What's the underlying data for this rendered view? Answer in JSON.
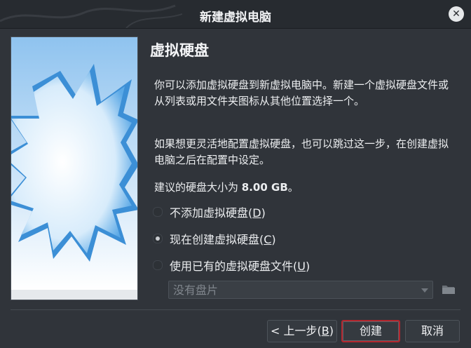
{
  "window": {
    "title": "新建虚拟电脑",
    "close_icon": "close-icon"
  },
  "page": {
    "title": "虚拟硬盘",
    "description_1": "你可以添加虚拟硬盘到新虚拟电脑中。新建一个虚拟硬盘文件或从列表或用文件夹图标从其他位置选择一个。",
    "description_2": "如果想更灵活地配置虚拟硬盘，也可以跳过这一步，在创建虚拟电脑之后在配置中设定。",
    "recommend_prefix": "建议的硬盘大小为 ",
    "recommend_size": "8.00 GB",
    "recommend_suffix": "。"
  },
  "options": [
    {
      "label": "不添加虚拟硬盘(",
      "key": "D",
      "end": ")",
      "selected": false
    },
    {
      "label": "现在创建虚拟硬盘(",
      "key": "C",
      "end": ")",
      "selected": true
    },
    {
      "label": "使用已有的虚拟硬盘文件(",
      "key": "U",
      "end": ")",
      "selected": false
    }
  ],
  "disk_select": {
    "value": "没有盘片",
    "enabled": false
  },
  "buttons": {
    "back_prefix": "< 上一步(",
    "back_key": "B",
    "back_suffix": ")",
    "create": "创建",
    "cancel": "取消"
  },
  "colors": {
    "default_button_border": "#b3262e",
    "background": "#30343a"
  }
}
